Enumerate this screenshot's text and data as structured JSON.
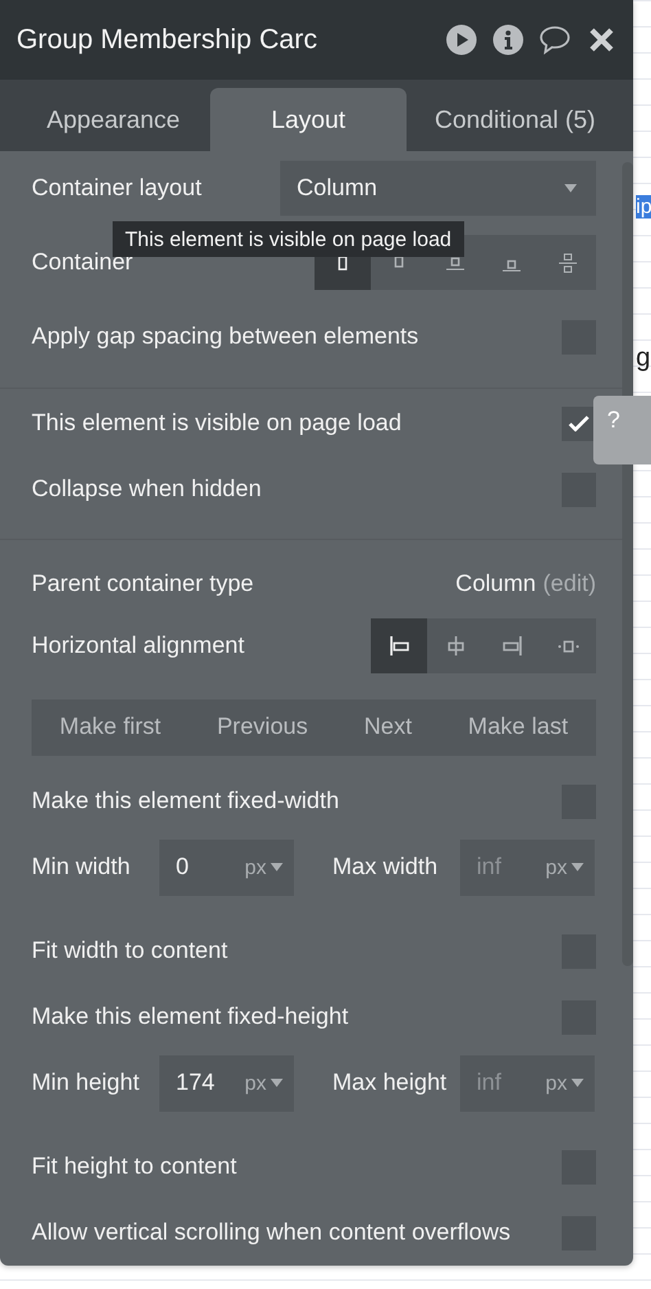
{
  "window": {
    "title": "Group Membership Carc"
  },
  "tabs": [
    {
      "label": "Appearance",
      "selected": false
    },
    {
      "label": "Layout",
      "selected": true
    },
    {
      "label": "Conditional (5)",
      "selected": false
    }
  ],
  "tooltip": "This element is visible on page load",
  "sections": [
    [
      {
        "kind": "dropdown",
        "label": "Container layout",
        "value": "Column"
      },
      {
        "kind": "segmented",
        "label": "Container",
        "options": [
          {
            "selected": true
          },
          {
            "selected": false
          },
          {
            "selected": false
          },
          {
            "selected": false
          },
          {
            "selected": false
          }
        ]
      },
      {
        "kind": "checkbox",
        "label": "Apply gap spacing between elements",
        "checked": false
      }
    ],
    [
      {
        "kind": "checkbox",
        "label": "This element is visible on page load",
        "checked": true
      },
      {
        "kind": "checkbox",
        "label": "Collapse when hidden",
        "checked": false
      }
    ],
    [
      {
        "kind": "info",
        "label": "Parent container type",
        "value": "Column",
        "link": "(edit)"
      },
      {
        "kind": "segmented",
        "label": "Horizontal alignment",
        "options": [
          {
            "selected": true
          },
          {
            "selected": false
          },
          {
            "selected": false
          },
          {
            "selected": false
          }
        ]
      },
      {
        "kind": "buttons",
        "items": [
          "Make first",
          "Previous",
          "Next",
          "Make last"
        ]
      },
      {
        "kind": "checkbox",
        "label": "Make this element fixed-width",
        "checked": false
      },
      {
        "kind": "sizes",
        "min": {
          "label": "Min width",
          "value": "0",
          "unit": "px"
        },
        "max": {
          "label": "Max width",
          "placeholder": "inf",
          "unit": "px"
        }
      },
      {
        "kind": "checkbox",
        "label": "Fit width to content",
        "checked": false
      },
      {
        "kind": "checkbox",
        "label": "Make this element fixed-height",
        "checked": false
      },
      {
        "kind": "sizes",
        "min": {
          "label": "Min height",
          "value": "174",
          "unit": "px"
        },
        "max": {
          "label": "Max height",
          "placeholder": "inf",
          "unit": "px"
        }
      },
      {
        "kind": "checkbox",
        "label": "Fit height to content",
        "checked": false
      },
      {
        "kind": "checkbox",
        "label": "Allow vertical scrolling when content overflows",
        "checked": false
      }
    ]
  ],
  "canvas": {
    "help": "?",
    "fragments": [
      {
        "kind": "label",
        "text": "ip"
      },
      {
        "kind": "plain",
        "text": "g"
      }
    ]
  }
}
